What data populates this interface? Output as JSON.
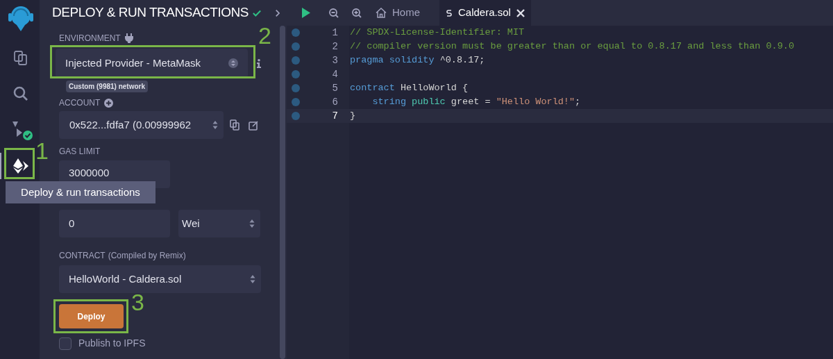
{
  "icon_bar": [
    {
      "kind": "logo",
      "selected": false
    },
    {
      "kind": "files",
      "selected": false
    },
    {
      "kind": "search",
      "selected": false
    },
    {
      "kind": "compiler",
      "selected": false
    },
    {
      "kind": "deploy",
      "selected": true
    }
  ],
  "tooltip": "Deploy & run transactions",
  "panel": {
    "title": "DEPLOY & RUN TRANSACTIONS",
    "environment": {
      "label": "ENVIRONMENT",
      "value": "Injected Provider - MetaMask",
      "network": "Custom (9981) network"
    },
    "account": {
      "label": "ACCOUNT",
      "value": "0x522...fdfa7 (0.00999962"
    },
    "gas_limit": {
      "label": "GAS LIMIT",
      "value": "3000000"
    },
    "value": {
      "amount": "0",
      "unit": "Wei"
    },
    "contract": {
      "label": "CONTRACT",
      "note": "(Compiled by Remix)",
      "value": "HelloWorld - Caldera.sol"
    },
    "deploy_button": "Deploy",
    "publish": {
      "label": "Publish to IPFS",
      "checked": false
    }
  },
  "editor": {
    "tabs": [
      {
        "kind": "home",
        "label": "Home",
        "selected": false
      },
      {
        "kind": "file",
        "label": "Caldera.sol",
        "selected": true
      }
    ],
    "lines": [
      {
        "number": "1",
        "current": false,
        "tokens": [
          {
            "kind": "comment",
            "text": "// SPDX-License-Identifier: MIT"
          }
        ]
      },
      {
        "number": "2",
        "current": false,
        "tokens": [
          {
            "kind": "comment",
            "text": "// compiler version must be greater than or equal to 0.8.17 and less than 0.9.0"
          }
        ]
      },
      {
        "number": "3",
        "current": false,
        "tokens": [
          {
            "kind": "keyword",
            "text": "pragma"
          },
          {
            "kind": "keyword",
            "text": " solidity"
          },
          {
            "kind": "plain",
            "text": " ^0.8.17;"
          }
        ]
      },
      {
        "number": "4",
        "current": false
      },
      {
        "number": "5",
        "current": false,
        "tokens": [
          {
            "kind": "keyword",
            "text": "contract"
          },
          {
            "kind": "plain",
            "text": " HelloWorld {"
          }
        ]
      },
      {
        "number": "6",
        "current": false,
        "tokens": [
          {
            "kind": "keyword",
            "text": "    string"
          },
          {
            "kind": "modifier",
            "text": " public"
          },
          {
            "kind": "plain",
            "text": " greet = "
          },
          {
            "kind": "string",
            "text": "\"Hello World!\""
          },
          {
            "kind": "plain",
            "text": ";"
          }
        ]
      },
      {
        "number": "7",
        "current": true,
        "tokens": [
          {
            "kind": "plain",
            "text": "}"
          }
        ]
      }
    ]
  },
  "callouts": [
    "1",
    "2",
    "3"
  ]
}
